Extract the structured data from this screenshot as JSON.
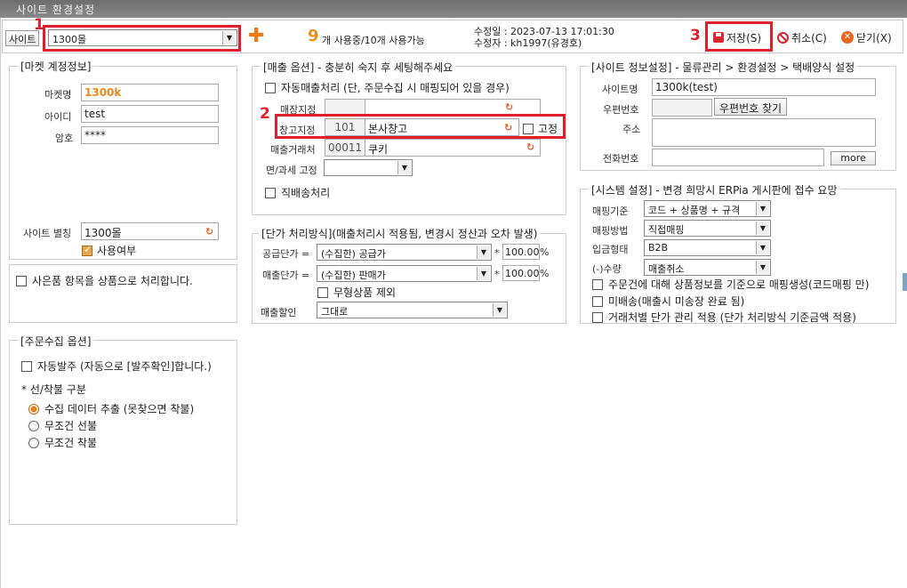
{
  "window": {
    "title": "사이트 환경설정"
  },
  "toolbar": {
    "site_button": "사이트",
    "site_value": "1300몰",
    "usage_count": "9",
    "usage_text": "개 사용중/10개 사용가능",
    "modified_date": "수정일 : 2023-07-13 17:01:30",
    "modifier": "수정자 : kh1997(유경호)",
    "save": "저장(S)",
    "cancel": "취소(C)",
    "close": "닫기(X)"
  },
  "annotations": {
    "n1": "1",
    "n2": "2",
    "n3": "3"
  },
  "market": {
    "title": "[마켓 계정정보]",
    "market_name_label": "마켓명",
    "market_name_value": "1300k",
    "id_label": "아이디",
    "id_value": "test",
    "pw_label": "암호",
    "pw_value": "****",
    "nickname_label": "사이트 별칭",
    "nickname_value": "1300몰",
    "use_label": "사용여부"
  },
  "gift": {
    "label": "사은품 항목을 상품으로 처리합니다."
  },
  "order": {
    "title": "[주문수집 옵션]",
    "auto_order": "자동발주 (자동으로 [발주확인]합니다.)",
    "section_label": "* 선/착불 구분",
    "radio1": "수집 데이터 추출 (못찾으면 착불)",
    "radio2": "무조건 선불",
    "radio3": "무조건 착불"
  },
  "sales": {
    "title": "[매출 옵션] - 충분히 숙지 후 세팅해주세요",
    "auto_sales": "자동매출처리 (단, 주문수집 시 매핑되어 있을 경우)",
    "store_label": "매장지정",
    "warehouse_label": "창고지정",
    "warehouse_code": "101",
    "warehouse_name": "본사창고",
    "fixed_label": "고정",
    "customer_label": "매출거래처",
    "customer_code": "00011",
    "customer_name": "쿠키",
    "tax_label": "면/과세 고정",
    "direct_label": "직배송처리"
  },
  "price": {
    "title": "[단가 처리방식](매출처리시 적용됨, 변경시 정산과 오차 발생)",
    "supply_label": "공급단가 =",
    "supply_value": "(수집한) 공급가",
    "supply_percent": "100.00",
    "sale_label": "매출단가 =",
    "sale_value": "(수집한) 판매가",
    "exclude_label": "무형상품 제외",
    "discount_label": "매출할인",
    "discount_value": "그대로",
    "times": "*",
    "percent_sign": "%"
  },
  "site_info": {
    "title": "[사이트 정보설정] - 물류관리 > 환경설정 > 택배양식 설정",
    "name_label": "사이트명",
    "name_value": "1300k(test)",
    "zip_label": "우편번호",
    "zip_button": "우편번호 찾기",
    "addr_label": "주소",
    "phone_label": "전화번호",
    "more_button": "more"
  },
  "system": {
    "title": "[시스템 설정] - 변경 희망시 ERPia 게시판에 접수 요망",
    "mapping_std_label": "매핑기준",
    "mapping_std_value": "코드 + 상품명 + 규격",
    "mapping_method_label": "매핑방법",
    "mapping_method_value": "직접매핑",
    "deposit_label": "입금형태",
    "deposit_value": "B2B",
    "qty_label": "(-)수량",
    "qty_value": "매출취소",
    "check1": "주문건에 대해 상품정보를 기준으로 매핑생성(코드매핑 만)",
    "check2": "미배송(매출시 미송장 완료 됨)",
    "check3": "거래처별 단가 관리 적용 (단가 처리방식 기준금액 적용)"
  }
}
